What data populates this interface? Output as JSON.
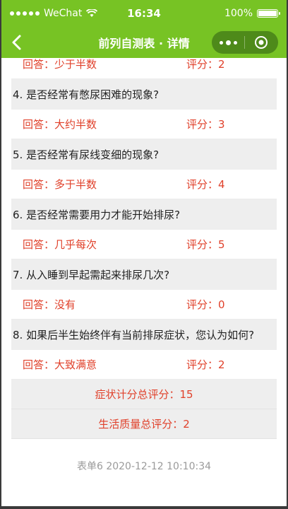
{
  "status_bar": {
    "carrier": "WeChat",
    "time": "16:34",
    "battery_label": "100%",
    "battery_level": 1.0
  },
  "nav": {
    "title": "前列自测表 · 详情"
  },
  "answer_prefix": "回答：",
  "score_prefix": "评分：",
  "items": [
    {
      "question": "",
      "answer": "少于半数",
      "score": "2"
    },
    {
      "question": "4. 是否经常有憋尿困难的现象?",
      "answer": "大约半数",
      "score": "3"
    },
    {
      "question": "5. 是否经常有尿线变细的现象?",
      "answer": "多于半数",
      "score": "4"
    },
    {
      "question": "6. 是否经常需要用力才能开始排尿?",
      "answer": "几乎每次",
      "score": "5"
    },
    {
      "question": "7. 从入睡到早起需起来排尿几次?",
      "answer": "没有",
      "score": "0"
    },
    {
      "question": "8. 如果后半生始终伴有当前排尿症状，您认为如何?",
      "answer": "大致满意",
      "score": "2"
    }
  ],
  "totals": {
    "symptom": "症状计分总评分：15",
    "quality": "生活质量总评分：2"
  },
  "footer": "表单6 2020-12-12 10:10:34",
  "colors": {
    "brand": "#77c324",
    "answer": "#e0402a"
  }
}
